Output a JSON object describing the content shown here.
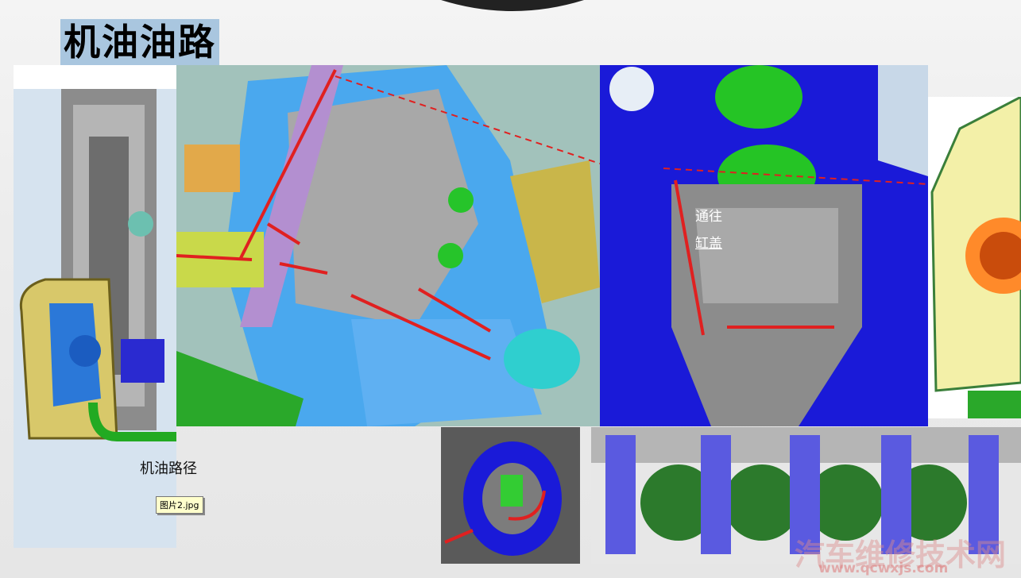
{
  "slide": {
    "title": "机油油路",
    "labels": {
      "oil_path": "机油路径",
      "to_line1": "通往",
      "to_line2": "缸盖",
      "file_tag": "图片2.jpg"
    },
    "watermark": {
      "text": "汽车维修技术网",
      "url": "www.qcwxjs.com"
    }
  },
  "colors": {
    "title_bg": "#a9c6df",
    "arrow": "#e02020",
    "block_blue": "#1a1ad8",
    "engine_cyan": "#39a8e8",
    "pipe_green": "#22aa22"
  },
  "icons": [
    "flow-arrow",
    "dashed-flow-arrow"
  ]
}
